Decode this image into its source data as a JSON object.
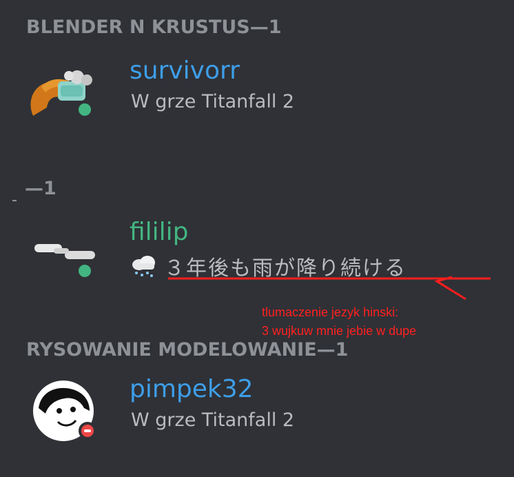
{
  "sections": [
    {
      "header": "BLENDER N KRUSTUS—1"
    },
    {
      "header": "—1"
    },
    {
      "header": "RYSOWANIE MODELOWANIE—1"
    }
  ],
  "members": [
    {
      "username": "survivorr",
      "username_color": "#3e9ee8",
      "activity": "W grze Titanfall 2",
      "status": "online"
    },
    {
      "username": "fililip",
      "username_color": "#43b581",
      "custom_status_emoji": "cloud-with-snow",
      "custom_status": "３年後も雨が降り続ける",
      "status": "online"
    },
    {
      "username": "pimpek32",
      "username_color": "#3e9ee8",
      "activity": "W grze Titanfall 2",
      "status": "dnd"
    }
  ],
  "annotation": {
    "line1": "tlumaczenie jezyk hinski:",
    "line2": "3 wujkuw mnie jebie w dupe",
    "color": "#ff2020"
  }
}
